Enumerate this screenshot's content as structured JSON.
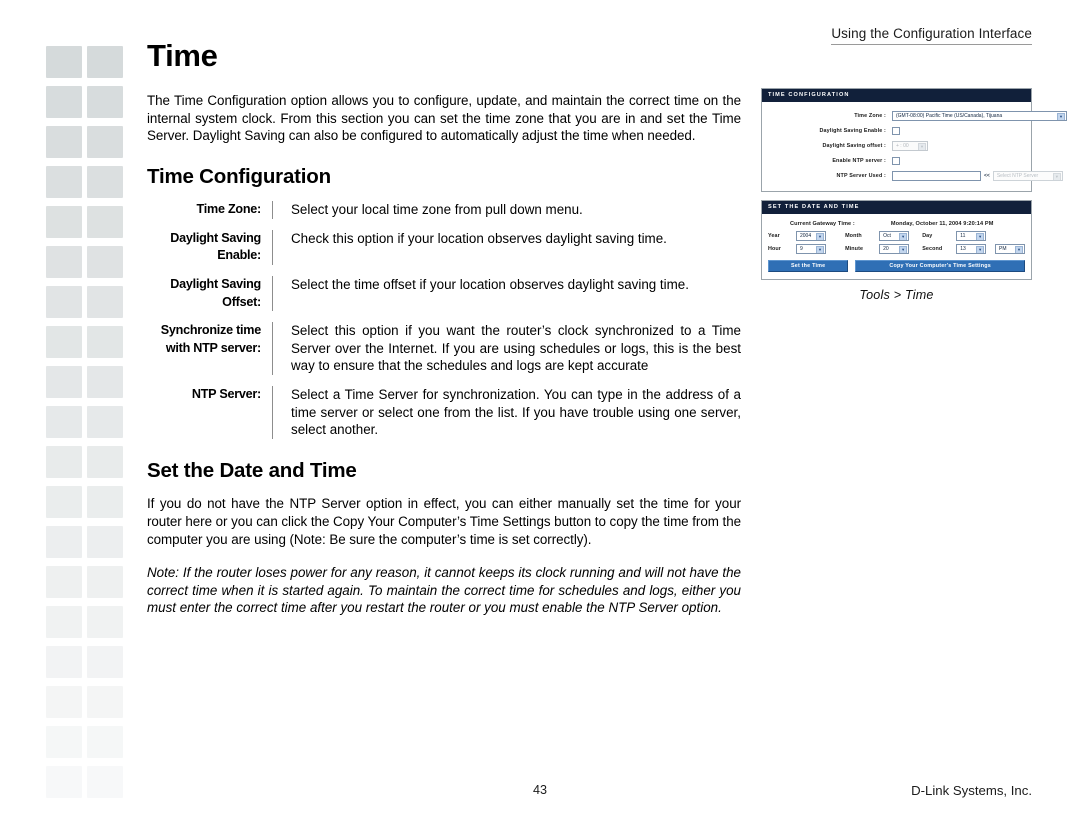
{
  "header": {
    "running_head": "Using the Configuration Interface"
  },
  "content": {
    "page_title": "Time",
    "intro_paragraph": "The Time Configuration option allows you to configure, update, and maintain the correct time on the internal system clock.  From this section you can set the time zone that you are in and set the Time Server. Daylight Saving can also be configured to automatically adjust the time when needed.",
    "section_time_configuration": "Time Configuration",
    "definitions": [
      {
        "term": "Time Zone:",
        "description": "Select your local time zone from pull down menu."
      },
      {
        "term": "Daylight Saving Enable:",
        "description": "Check this option if your location observes daylight saving time."
      },
      {
        "term": "Daylight Saving Offset:",
        "description": "Select the time offset if your location observes daylight saving time."
      },
      {
        "term": "Synchronize time with NTP server:",
        "description": "Select this option if you want the router’s clock synchronized to a Time Server over the Internet. If you are using schedules or logs, this is the best way to ensure that the schedules and logs are kept accurate"
      },
      {
        "term": "NTP Server:",
        "description": "Select a Time Server for synchronization. You can type in the address of a time server or select one from the list. If you have trouble using one server, select another."
      }
    ],
    "section_set_date_time": "Set the Date and Time",
    "set_date_paragraph": "If you do not have the NTP Server option in effect, you can either manually set the time for your router here or you can click the Copy Your Computer’s Time Settings button to copy the time from the computer you are using (Note: Be sure the computer’s time is set correctly).",
    "note_paragraph": "Note: If the router loses power for any reason, it cannot keeps its clock running and will not have the correct time when it is started again. To maintain the correct time for schedules and logs, either you must enter the correct time after you restart the router or you must enable the NTP Server option."
  },
  "figure": {
    "caption": "Tools > Time",
    "time_configuration": {
      "panel_title": "TIME CONFIGURATION",
      "rows": {
        "time_zone_label": "Time Zone :",
        "time_zone_value": "(GMT-08:00) Pacific Time (US/Canada), Tijuana",
        "daylight_saving_enable_label": "Daylight Saving Enable :",
        "daylight_saving_offset_label": "Daylight Saving offset :",
        "daylight_saving_offset_value": "+ : 00",
        "enable_ntp_server_label": "Enable NTP server :",
        "ntp_server_used_label": "NTP Server Used :",
        "ntp_server_used_value": "",
        "ntp_and_text": "<<",
        "ntp_select_value": "Select NTP Server"
      }
    },
    "set_date_and_time": {
      "panel_title": "SET THE DATE AND TIME",
      "current_gateway_time_label": "Current Gateway Time :",
      "current_gateway_time_value": "Monday, October 11, 2004 9:20:14 PM",
      "fields": {
        "year_label": "Year",
        "year_value": "2004",
        "month_label": "Month",
        "month_value": "Oct",
        "day_label": "Day",
        "day_value": "11",
        "hour_label": "Hour",
        "hour_value": "9",
        "minute_label": "Minute",
        "minute_value": "20",
        "second_label": "Second",
        "second_value": "13",
        "ampm_value": "PM"
      },
      "buttons": {
        "set_time": "Set the Time",
        "copy_computer_time": "Copy Your Computer's Time Settings"
      }
    }
  },
  "footer": {
    "page_number": "43",
    "brand": "D-Link Systems, Inc."
  },
  "colors": {
    "panel_header_bg": "#11203a",
    "button_bg": "#2f6fb5",
    "deco_square": "#d5dadb",
    "rule": "#8d8d8d"
  }
}
